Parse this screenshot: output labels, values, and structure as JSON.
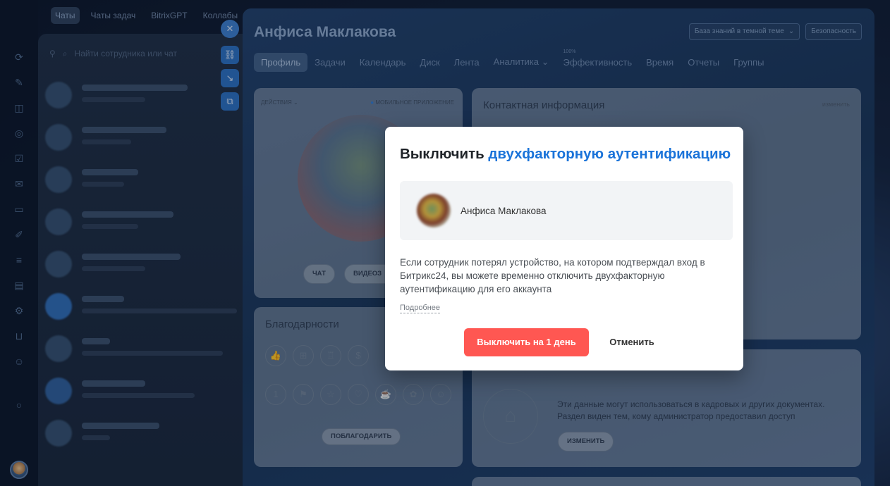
{
  "chat_tabs": [
    "Чаты",
    "Чаты задач",
    "BitrixGPT",
    "Коллабы"
  ],
  "chat_search": {
    "placeholder": "Найти сотрудника или чат"
  },
  "profile": {
    "title": "Анфиса Маклакова",
    "top_buttons": {
      "knowledge_base": "База знаний в темной теме",
      "security": "Безопасность"
    },
    "nav": [
      {
        "label": "Профиль"
      },
      {
        "label": "Задачи"
      },
      {
        "label": "Календарь"
      },
      {
        "label": "Диск"
      },
      {
        "label": "Лента"
      },
      {
        "label": "Аналитика"
      },
      {
        "label": "Эффективность",
        "sup": "100%"
      },
      {
        "label": "Время"
      },
      {
        "label": "Отчеты"
      },
      {
        "label": "Группы"
      }
    ],
    "actions_label": "ДЕЙСТВИЯ",
    "mobile_app_label": "МОБИЛЬНОЕ ПРИЛОЖЕНИЕ",
    "chat_button": "ЧАТ",
    "video_button": "ВИДЕОЗ",
    "contact_card_title": "Контактная информация",
    "contact_edit": "изменить",
    "thanks_title": "Благодарности",
    "thank_button": "ПОБЛАГОДАРИТЬ",
    "hr_text": "Эти данные могут использоваться в кадровых и других документах. Раздел виден тем, кому администратор предоставил доступ",
    "hr_edit_button": "ИЗМЕНИТЬ"
  },
  "modal": {
    "title_prefix": "Выключить",
    "title_accent": "двухфакторную аутентификацию",
    "user_name": "Анфиса Маклакова",
    "description": "Если сотрудник потерял устройство, на котором подтверждал вход в Битрикс24, вы можете временно отключить двухфакторную аутентификацию для его аккаунта",
    "more_link": "Подробнее",
    "primary_button": "Выключить на 1 день",
    "cancel_button": "Отменить",
    "accent_color": "#1a73d9",
    "primary_color": "#ff5752"
  }
}
